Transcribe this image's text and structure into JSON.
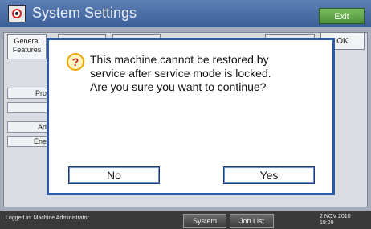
{
  "window": {
    "title": "System Settings",
    "exit_label": "Exit"
  },
  "tabs": {
    "general": "General Features",
    "ok_label": "OK"
  },
  "sidebar": {
    "items": [
      {
        "label": "Pro"
      },
      {
        "label": ""
      },
      {
        "label": "Ad"
      },
      {
        "label": "Ene"
      }
    ]
  },
  "dialog": {
    "icon": "question-icon",
    "message_lines": [
      "This machine cannot be restored by",
      "service after service mode is locked.",
      "Are you sure you want to continue?"
    ],
    "no_label": "No",
    "yes_label": "Yes"
  },
  "statusbar": {
    "login_text": "Logged in: Machine Administrator",
    "system_status_label": "System Status",
    "job_list_label": "Job List",
    "date": "2 NOV  2010",
    "time": "19:09"
  },
  "colors": {
    "title_bar": "#3b5f97",
    "exit_button": "#4d8e38",
    "dialog_border": "#2a5aa8",
    "status_bar": "#3a3a3a"
  }
}
